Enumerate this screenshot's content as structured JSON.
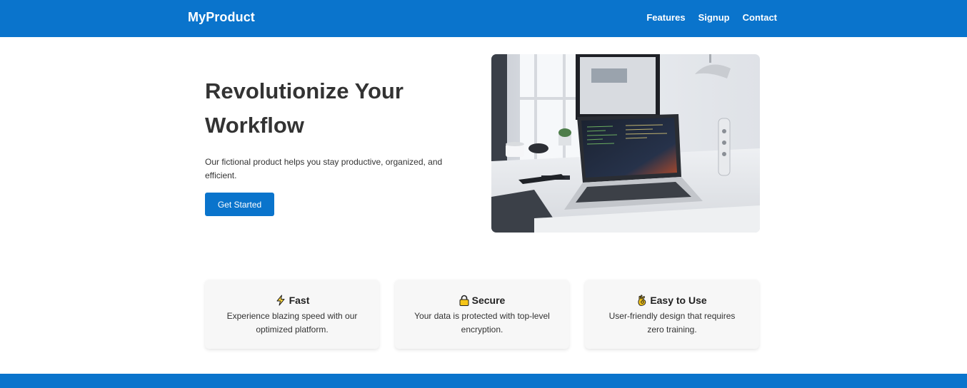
{
  "header": {
    "brand": "MyProduct",
    "nav": [
      {
        "label": "Features"
      },
      {
        "label": "Signup"
      },
      {
        "label": "Contact"
      }
    ]
  },
  "hero": {
    "title": "Revolutionize Your Workflow",
    "subtitle": "Our fictional product helps you stay productive, organized, and efficient.",
    "cta_label": "Get Started",
    "image_alt": "laptop on a desk"
  },
  "features": [
    {
      "icon": "lightning-icon",
      "title": "Fast",
      "desc": "Experience blazing speed with our optimized platform."
    },
    {
      "icon": "lock-icon",
      "title": "Secure",
      "desc": "Your data is protected with top-level encryption."
    },
    {
      "icon": "ok-hand-icon",
      "title": "Easy to Use",
      "desc": "User-friendly design that requires zero training."
    }
  ],
  "colors": {
    "brand": "#0a74cc",
    "text": "#333333",
    "card_bg": "#f7f7f7"
  }
}
